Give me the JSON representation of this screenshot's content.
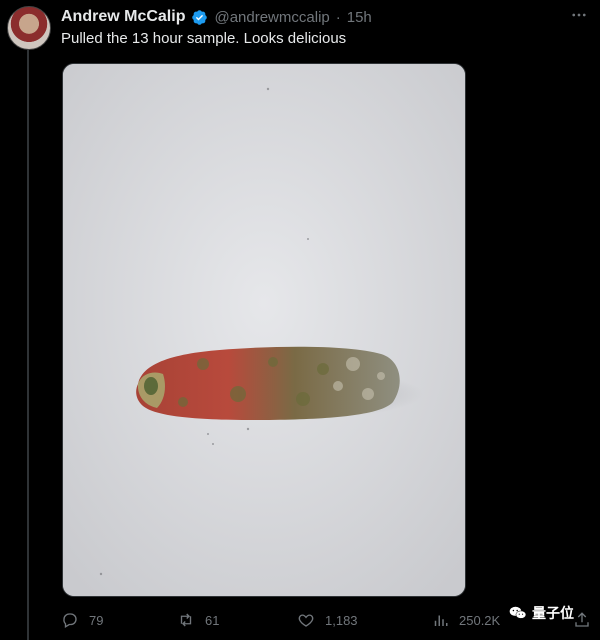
{
  "tweet": {
    "author_name": "Andrew McCalip",
    "handle": "@andrewmccalip",
    "separator": "·",
    "time": "15h",
    "text": "Pulled the 13 hour sample. Looks delicious"
  },
  "media": {
    "icon": "photo",
    "background_color": "#dcdde1",
    "subject_colors": [
      "#b84a3c",
      "#6d6a3d",
      "#9a9a8a"
    ]
  },
  "actions": {
    "replies": "79",
    "reposts": "61",
    "likes": "1,183",
    "views": "250.2K"
  },
  "watermark": {
    "text": "量子位"
  },
  "colors": {
    "verified": "#1d9bf0",
    "muted": "#71767b",
    "text": "#e7e9ea"
  }
}
